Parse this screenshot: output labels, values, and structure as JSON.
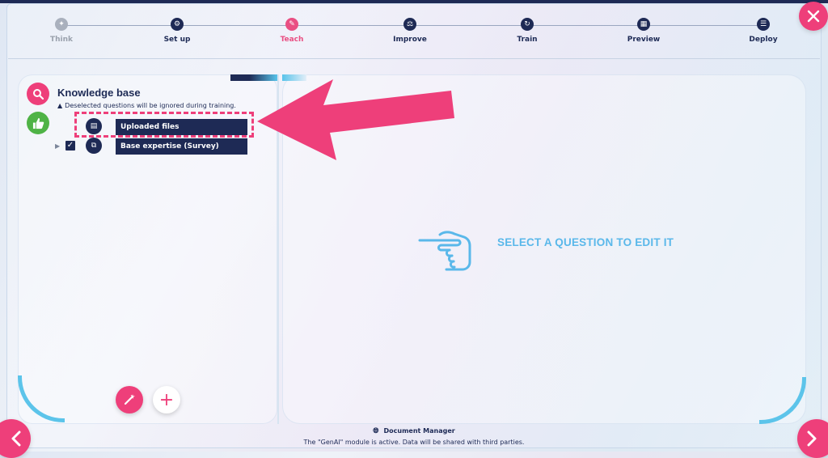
{
  "stepper": {
    "steps": [
      {
        "label": "Think",
        "icon": "bulb-icon",
        "state": "done"
      },
      {
        "label": "Set up",
        "icon": "gear-icon",
        "state": "todo"
      },
      {
        "label": "Teach",
        "icon": "pencil-icon",
        "state": "active"
      },
      {
        "label": "Improve",
        "icon": "improve-icon",
        "state": "todo"
      },
      {
        "label": "Train",
        "icon": "train-icon",
        "state": "todo"
      },
      {
        "label": "Preview",
        "icon": "preview-icon",
        "state": "todo"
      },
      {
        "label": "Deploy",
        "icon": "deploy-icon",
        "state": "todo"
      }
    ]
  },
  "buttons": {
    "close": "✕",
    "prev": "‹",
    "next": "›",
    "wand": "✎",
    "add": "+"
  },
  "knowledge_base": {
    "title": "Knowledge base",
    "note": "Deselected questions will be ignored during training.",
    "items": [
      {
        "label": "Uploaded files",
        "icon": "document-icon",
        "checked": false
      },
      {
        "label": "Base expertise (Survey)",
        "icon": "structure-icon",
        "checked": true
      }
    ]
  },
  "placeholder": {
    "text": "SELECT A QUESTION TO EDIT IT"
  },
  "footer": {
    "module": "Document Manager",
    "note": "The \"GenAI\" module is active. Data will be shared with third parties."
  },
  "colors": {
    "accent": "#ee3f7a",
    "navy": "#1e2a55",
    "cyan": "#5cc4ea",
    "green": "#4fb346"
  }
}
